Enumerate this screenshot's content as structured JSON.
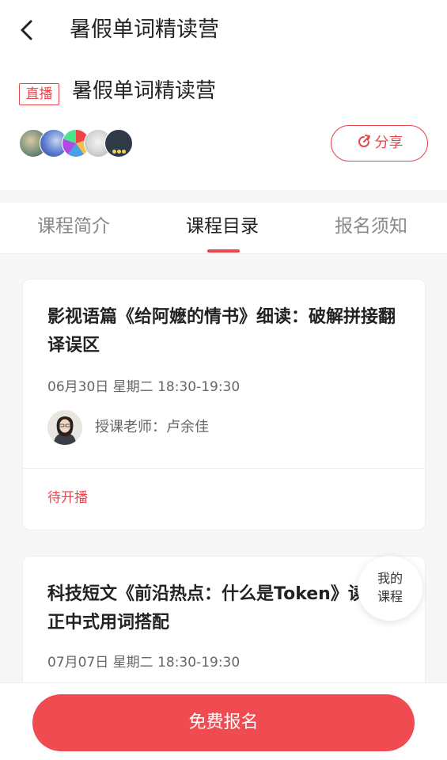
{
  "nav": {
    "title": "暑假单词精读营",
    "back_icon": "back-arrow-icon"
  },
  "header": {
    "badge": "直播",
    "course_title": "暑假单词精读营",
    "share_label": "分享",
    "share_icon": "share-refresh-icon",
    "accent_color": "#e8474b"
  },
  "tabs": [
    {
      "label": "课程简介",
      "active": false
    },
    {
      "label": "课程目录",
      "active": true
    },
    {
      "label": "报名须知",
      "active": false
    }
  ],
  "lessons": [
    {
      "title": "影视语篇《给阿嬷的情书》细读：破解拼接翻译误区",
      "time": "06月30日 星期二 18:30-19:30",
      "teacher": "授课老师：卢余佳",
      "status": "待开播"
    },
    {
      "title": "科技短文《前沿热点：什么是Token》读：修正中式用词搭配",
      "time": "07月07日 星期二 18:30-19:30"
    }
  ],
  "floating": {
    "label_line1": "我的",
    "label_line2": "课程"
  },
  "bottom": {
    "signup_label": "免费报名"
  }
}
